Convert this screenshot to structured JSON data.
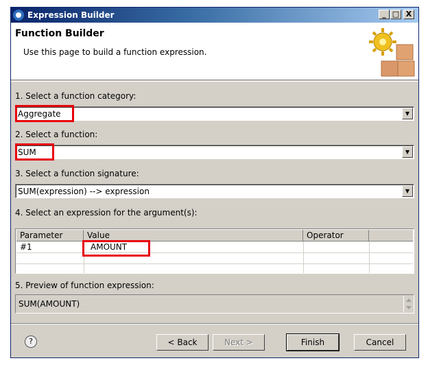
{
  "window": {
    "title": "Expression Builder",
    "controls": [
      "_",
      "□",
      "X"
    ]
  },
  "header": {
    "title": "Function Builder",
    "description": "Use this page to build a function expression.",
    "icon": "gear-blocks-icon"
  },
  "step1": {
    "label": "1. Select a function category:",
    "value": "Aggregate"
  },
  "step2": {
    "label": "2. Select a function:",
    "value": "SUM"
  },
  "step3": {
    "label": "3. Select a function signature:",
    "value": "SUM(expression) --> expression"
  },
  "step4": {
    "label": "4. Select an expression for the argument(s):",
    "columns": [
      "Parameter",
      "Value",
      "Operator"
    ],
    "rows": [
      {
        "parameter": "#1",
        "value": "AMOUNT",
        "operator": ""
      }
    ]
  },
  "step5": {
    "label": "5. Preview of function expression:",
    "value": "SUM(AMOUNT)"
  },
  "buttons": {
    "back": "< Back",
    "next": "Next >",
    "finish": "Finish",
    "cancel": "Cancel",
    "help": "?"
  },
  "colors": {
    "highlight": "#e8000b",
    "title_bar": "#0a246a"
  }
}
